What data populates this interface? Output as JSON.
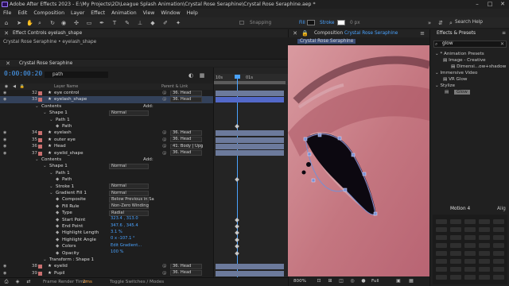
{
  "titlebar": {
    "text": "Adobe After Effects 2023 - E:\\My Projects\\2D\\League Splash Animation\\Crystal Rose Seraphine\\Crystal Rose Seraphine.aep *"
  },
  "menu": [
    "File",
    "Edit",
    "Composition",
    "Layer",
    "Effect",
    "Animation",
    "View",
    "Window",
    "Help"
  ],
  "toolbar": {
    "snapping": "Snapping",
    "fill": "Fill",
    "stroke": "Stroke",
    "stroke_width": "0 px",
    "help_search": "Search Help"
  },
  "effect_controls": {
    "tab": "Effect Controls eyelash_shape",
    "path": "Crystal Rose Seraphine • eyelash_shape"
  },
  "timeline": {
    "tab": "Crystal Rose Seraphine",
    "timecode": "0:00:00:20",
    "search": "path",
    "col_layer": "Layer Name",
    "col_parent": "Parent & Link",
    "ruler_a": "10s",
    "ruler_b": "01s"
  },
  "layers": [
    {
      "num": "32",
      "name": "eye control",
      "parent": "36. Head",
      "indent": 0,
      "kind": "layer"
    },
    {
      "num": "33",
      "name": "eyelash_shape",
      "parent": "36. Head",
      "indent": 0,
      "kind": "layer",
      "selected": true
    },
    {
      "name": "Contents",
      "indent": 1,
      "kind": "group",
      "add": "Add:"
    },
    {
      "name": "Shape 1",
      "indent": 2,
      "kind": "group",
      "value": "Normal"
    },
    {
      "name": "Path 1",
      "indent": 3,
      "kind": "group"
    },
    {
      "name": "Path",
      "indent": 4,
      "kind": "prop"
    },
    {
      "num": "34",
      "name": "eyelash",
      "parent": "36. Head",
      "indent": 0,
      "kind": "layer"
    },
    {
      "num": "35",
      "name": "outer eye",
      "parent": "36. Head",
      "indent": 0,
      "kind": "layer"
    },
    {
      "num": "36",
      "name": "Head",
      "parent": "41. Body | Upg",
      "indent": 0,
      "kind": "layer"
    },
    {
      "num": "37",
      "name": "eyelid_shape",
      "parent": "36. Head",
      "indent": 0,
      "kind": "layer"
    },
    {
      "name": "Contents",
      "indent": 1,
      "kind": "group",
      "add": "Add:"
    },
    {
      "name": "Shape 1",
      "indent": 2,
      "kind": "group",
      "value": "Normal"
    },
    {
      "name": "Path 1",
      "indent": 3,
      "kind": "group"
    },
    {
      "name": "Path",
      "indent": 4,
      "kind": "prop"
    },
    {
      "name": "Stroke 1",
      "indent": 3,
      "kind": "group",
      "value": "Normal"
    },
    {
      "name": "Gradient Fill 1",
      "indent": 3,
      "kind": "group",
      "value": "Normal"
    },
    {
      "name": "Composite",
      "indent": 4,
      "kind": "prop",
      "value": "Below Previous in Sa"
    },
    {
      "name": "Fill Rule",
      "indent": 4,
      "kind": "prop",
      "value": "Non-Zero Winding"
    },
    {
      "name": "Type",
      "indent": 4,
      "kind": "prop",
      "value": "Radial"
    },
    {
      "name": "Start Point",
      "indent": 4,
      "kind": "prop",
      "blue": "323.4 , 313.0"
    },
    {
      "name": "End Point",
      "indent": 4,
      "kind": "prop",
      "blue": "347.6 , 345.4"
    },
    {
      "name": "Highlight Length",
      "indent": 4,
      "kind": "prop",
      "blue": "3.1 %"
    },
    {
      "name": "Highlight Angle",
      "indent": 4,
      "kind": "prop",
      "blue": "0 x -107.1 °"
    },
    {
      "name": "Colors",
      "indent": 4,
      "kind": "prop",
      "blue": "Edit Gradient..."
    },
    {
      "name": "Opacity",
      "indent": 4,
      "kind": "prop",
      "blue": "100 %"
    },
    {
      "name": "Transform : Shape 1",
      "indent": 2,
      "kind": "group"
    },
    {
      "num": "38",
      "name": "eyelid",
      "parent": "36. Head",
      "indent": 0,
      "kind": "layer"
    },
    {
      "num": "39",
      "name": "Pupil",
      "parent": "36. Head",
      "indent": 0,
      "kind": "layer"
    }
  ],
  "status": {
    "render_label": "Frame Render Time",
    "render_value": "2ms",
    "toggle": "Toggle Switches / Modes"
  },
  "composition": {
    "tab_prefix": "Composition",
    "name": "Crystal Rose Seraphine",
    "subtab": "Crystal Rose Seraphine",
    "zoom": "800%",
    "resolution": "Full"
  },
  "effects_presets": {
    "tab": "Effects & Presets",
    "search": "glow",
    "tree": [
      {
        "label": "* Animation Presets",
        "level": 0
      },
      {
        "label": "Image - Creative",
        "level": 1
      },
      {
        "label": "Dimensi...ow+shadow",
        "level": 2
      },
      {
        "label": "Immersive Video",
        "level": 0
      },
      {
        "label": "VR Glow",
        "level": 1
      },
      {
        "label": "Stylize",
        "level": 0
      }
    ],
    "glow": "Glow"
  },
  "motion": {
    "tab": "Motion 4",
    "align": "Alig"
  },
  "colors": {
    "accent": "#4aa3ff",
    "selection": "#5369c9",
    "skin": "#c77a84",
    "render_time": "#ffa640"
  }
}
